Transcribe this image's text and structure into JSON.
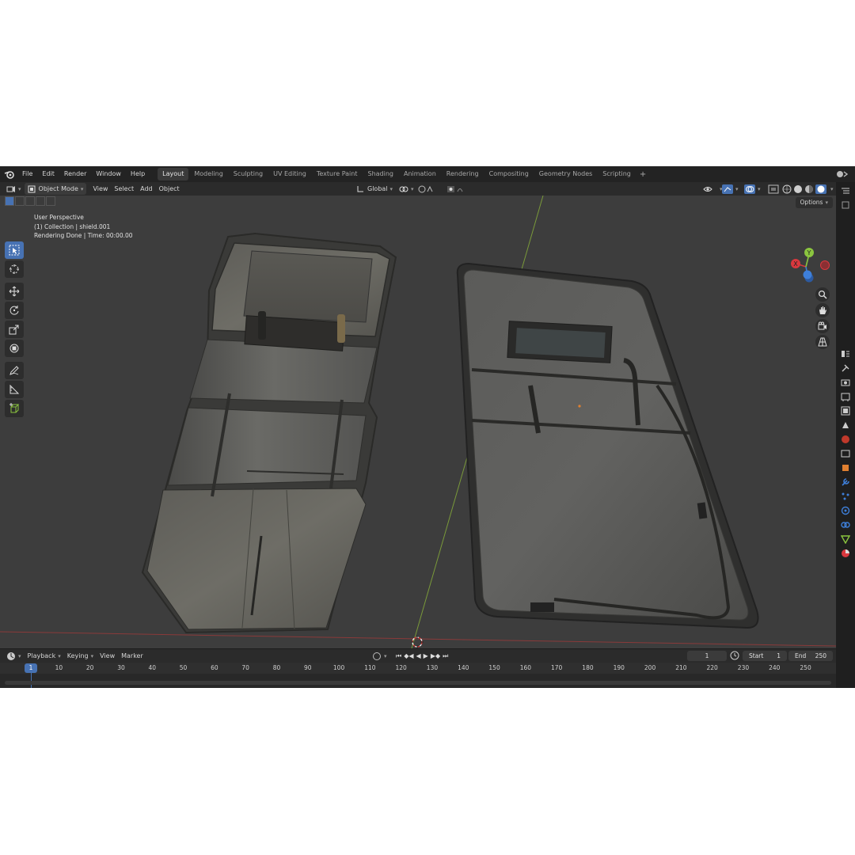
{
  "topbar": {
    "menus": [
      "File",
      "Edit",
      "Render",
      "Window",
      "Help"
    ],
    "workspaces": [
      "Layout",
      "Modeling",
      "Sculpting",
      "UV Editing",
      "Texture Paint",
      "Shading",
      "Animation",
      "Rendering",
      "Compositing",
      "Geometry Nodes",
      "Scripting"
    ],
    "active_workspace": "Layout"
  },
  "viewport_header": {
    "mode": "Object Mode",
    "menus": [
      "View",
      "Select",
      "Add",
      "Object"
    ],
    "transform_orientation": "Global",
    "options_label": "Options"
  },
  "viewport_info": {
    "line1": "User Perspective",
    "line2": "(1) Collection | shield.001",
    "line3": "Rendering Done | Time: 00:00.00"
  },
  "gizmo": {
    "x_label": "X",
    "y_label": "Y",
    "z_label": "Z"
  },
  "timeline": {
    "menus": [
      "Playback",
      "Keying",
      "View",
      "Marker"
    ],
    "current_frame": "1",
    "start_label": "Start",
    "start_value": "1",
    "end_label": "End",
    "end_value": "250",
    "ruler_current": "1",
    "ruler_ticks": [
      "10",
      "20",
      "30",
      "40",
      "50",
      "60",
      "70",
      "80",
      "90",
      "100",
      "110",
      "120",
      "130",
      "140",
      "150",
      "160",
      "170",
      "180",
      "190",
      "200",
      "210",
      "220",
      "230",
      "240",
      "250"
    ]
  },
  "colors": {
    "accent": "#4772b3",
    "x_axis": "#d9383e",
    "y_axis": "#8bc53f",
    "z_axis": "#3e7fd9",
    "viewport_bg": "#3d3d3d"
  }
}
